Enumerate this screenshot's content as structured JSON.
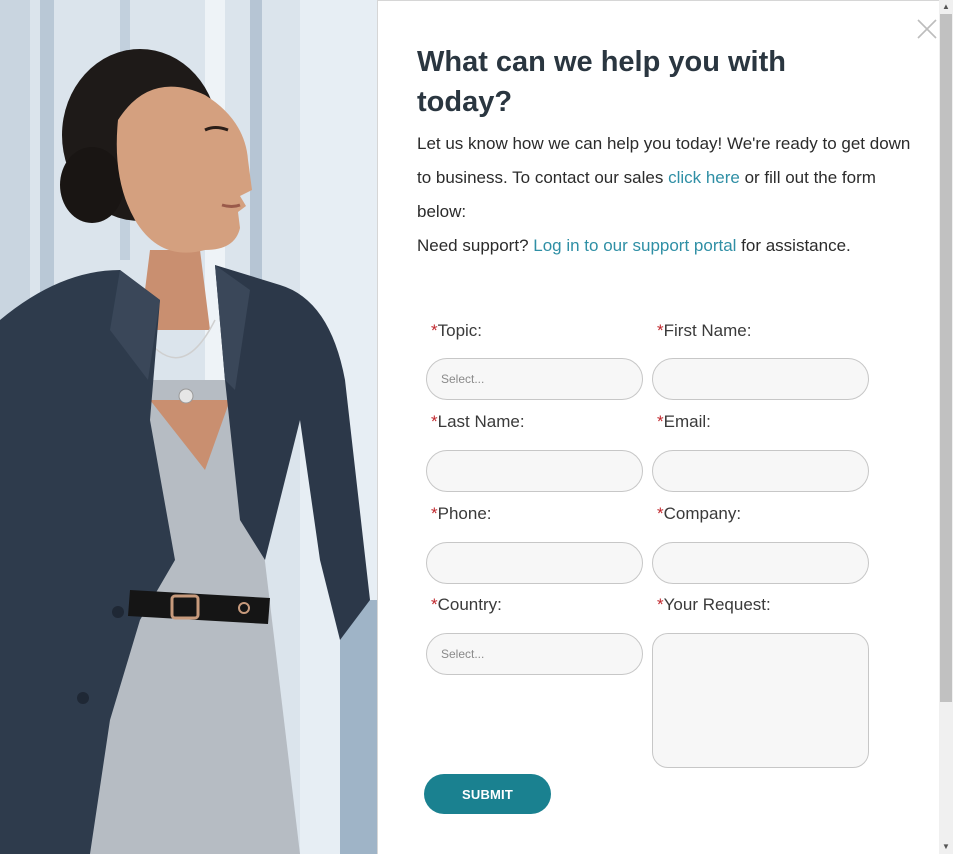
{
  "photo": {
    "alt": "Business woman in a navy blazer looking out a window"
  },
  "dialog": {
    "title": "What can we help you with today?",
    "intro": {
      "before": "Let us know how we can help you today! We're ready to get down to business. To contact our sales ",
      "link": "click here",
      "after": " or fill out the form below:"
    },
    "support": {
      "before": "Need support? ",
      "link": "Log in to our support portal",
      "after": " for assistance."
    },
    "form": {
      "required_mark": "*",
      "topic": {
        "label": "Topic:",
        "placeholder": "Select..."
      },
      "first_name": {
        "label": "First Name:",
        "value": ""
      },
      "last_name": {
        "label": "Last Name:",
        "value": ""
      },
      "email": {
        "label": "Email:",
        "value": ""
      },
      "phone": {
        "label": "Phone:",
        "value": ""
      },
      "company": {
        "label": "Company:",
        "value": ""
      },
      "country": {
        "label": "Country:",
        "placeholder": "Select..."
      },
      "request": {
        "label": "Your Request:",
        "value": ""
      },
      "submit_label": "SUBMIT"
    }
  },
  "colors": {
    "accent": "#1a8190",
    "link": "#2f8fa5",
    "required": "#c0272d",
    "title": "#2a3640"
  },
  "icons": {
    "close": "close-icon"
  }
}
